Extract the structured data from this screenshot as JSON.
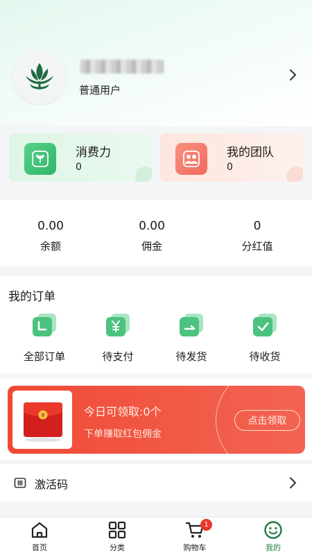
{
  "profile": {
    "level": "普通用户"
  },
  "cards": {
    "consumption": {
      "title": "消费力",
      "value": "0"
    },
    "team": {
      "title": "我的团队",
      "value": "0"
    }
  },
  "stats": [
    {
      "value": "0.00",
      "label": "余额"
    },
    {
      "value": "0.00",
      "label": "佣金"
    },
    {
      "value": "0",
      "label": "分红值"
    }
  ],
  "orders": {
    "title": "我的订单",
    "items": [
      {
        "label": "全部订单",
        "icon": "all-orders-icon"
      },
      {
        "label": "待支付",
        "icon": "pending-payment-icon"
      },
      {
        "label": "待发货",
        "icon": "pending-shipment-icon"
      },
      {
        "label": "待收货",
        "icon": "pending-receipt-icon"
      }
    ]
  },
  "banner": {
    "title": "今日可领取:0个",
    "subtitle": "下单赚取红包佣金",
    "button": "点击领取"
  },
  "menu": {
    "activation_code": "激活码"
  },
  "tabbar": {
    "items": [
      {
        "label": "首页",
        "icon": "home-icon"
      },
      {
        "label": "分类",
        "icon": "category-icon"
      },
      {
        "label": "购物车",
        "icon": "cart-icon",
        "badge": "1"
      },
      {
        "label": "我的",
        "icon": "smile-icon",
        "active": true
      }
    ]
  },
  "colors": {
    "accent_green": "#2fb46a",
    "active_tab": "#1f7a44",
    "banner_red": "#f04a36",
    "badge_red": "#e8392b"
  }
}
